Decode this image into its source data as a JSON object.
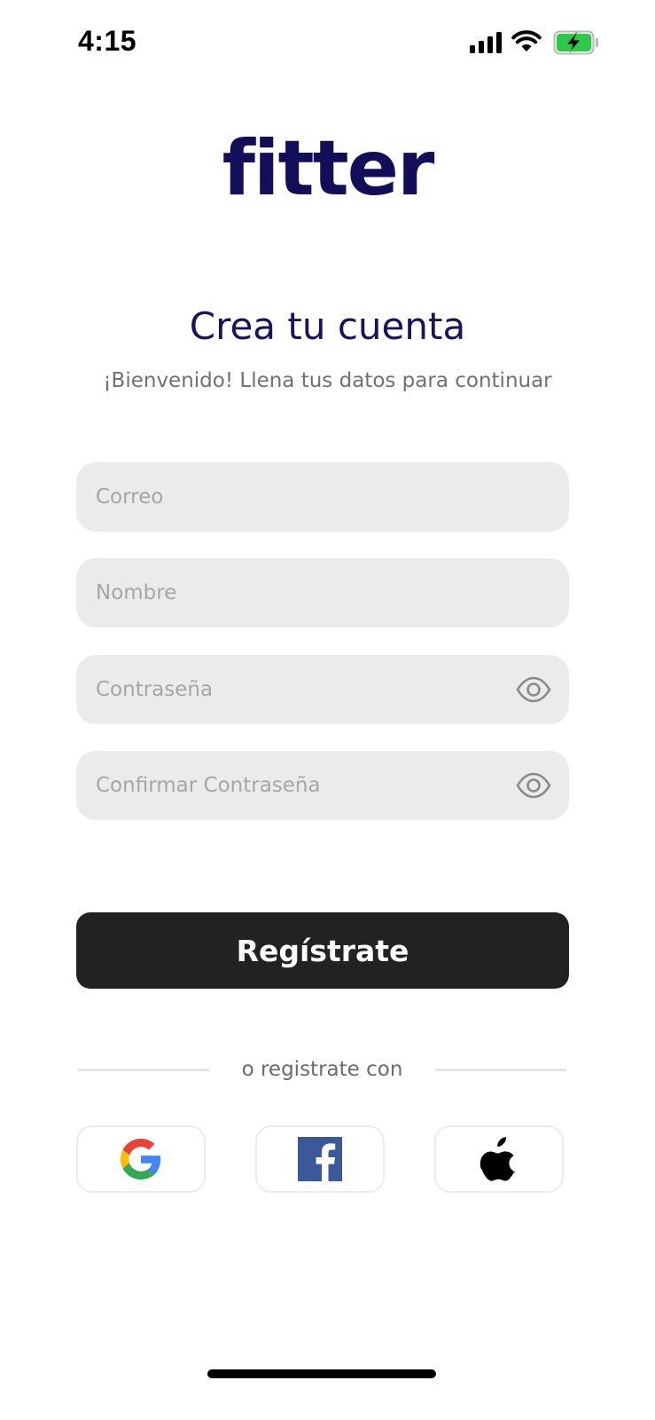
{
  "status_bar": {
    "time": "4:15",
    "icons": [
      "signal-icon",
      "wifi-icon",
      "battery-charging-icon"
    ],
    "battery_color": "#2fc94a"
  },
  "logo": {
    "text": "fitter",
    "color": "#120e5a"
  },
  "header": {
    "title": "Crea tu cuenta",
    "subtitle": "¡Bienvenido! Llena tus datos para continuar"
  },
  "form": {
    "email": {
      "placeholder": "Correo",
      "value": ""
    },
    "name": {
      "placeholder": "Nombre",
      "value": ""
    },
    "password": {
      "placeholder": "Contraseña",
      "value": "",
      "icon": "eye-icon"
    },
    "confirm_password": {
      "placeholder": "Confirmar Contraseña",
      "value": "",
      "icon": "eye-icon"
    }
  },
  "register_button": {
    "label": "Regístrate",
    "background": "#222222"
  },
  "social": {
    "divider_text": "o registrate con",
    "providers": [
      {
        "name": "Google",
        "icon": "google-icon"
      },
      {
        "name": "Facebook",
        "icon": "facebook-icon"
      },
      {
        "name": "Apple",
        "icon": "apple-icon"
      }
    ]
  }
}
